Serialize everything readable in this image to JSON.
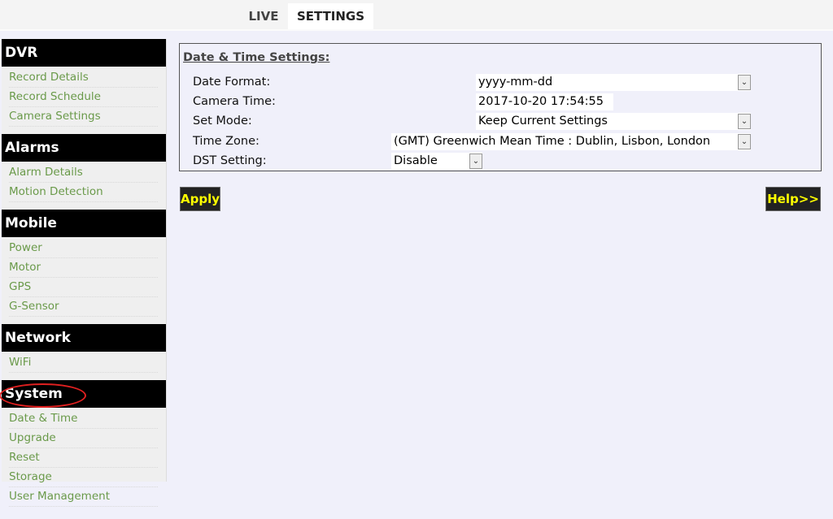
{
  "tabs": {
    "live": "LIVE",
    "settings": "SETTINGS"
  },
  "sidebar": [
    {
      "header": "DVR",
      "items": [
        "Record Details",
        "Record Schedule",
        "Camera Settings"
      ]
    },
    {
      "header": "Alarms",
      "items": [
        "Alarm Details",
        "Motion Detection"
      ]
    },
    {
      "header": "Mobile",
      "items": [
        "Power",
        "Motor",
        "GPS",
        "G-Sensor"
      ]
    },
    {
      "header": "Network",
      "items": [
        "WiFi"
      ]
    },
    {
      "header": "System",
      "items": [
        "Date & Time",
        "Upgrade",
        "Reset",
        "Storage",
        "User Management"
      ]
    }
  ],
  "panel": {
    "title": "Date & Time Settings:",
    "date_format_label": "Date Format:",
    "date_format": "yyyy-mm-dd",
    "camera_time_label": "Camera Time:",
    "camera_time": "2017-10-20 17:54:55",
    "set_mode_label": "Set Mode:",
    "set_mode": "Keep Current Settings",
    "time_zone_label": "Time Zone:",
    "time_zone": "(GMT) Greenwich Mean Time : Dublin, Lisbon, London",
    "dst_label": "DST Setting:",
    "dst": "Disable"
  },
  "buttons": {
    "apply": "Apply",
    "help": "Help>>"
  },
  "highlight_color": "#e02020"
}
